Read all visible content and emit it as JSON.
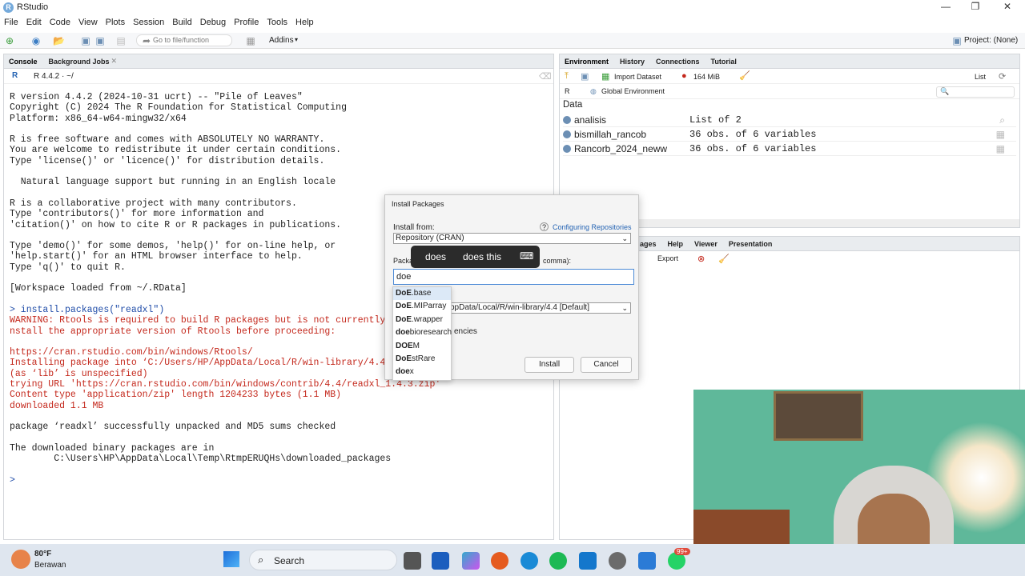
{
  "window": {
    "title": "RStudio"
  },
  "menu": [
    "File",
    "Edit",
    "Code",
    "View",
    "Plots",
    "Session",
    "Build",
    "Debug",
    "Profile",
    "Tools",
    "Help"
  ],
  "toolbar": {
    "goto_placeholder": "Go to file/function",
    "addins": "Addins",
    "project": "Project: (None)"
  },
  "console": {
    "tabs": [
      "Console",
      "Background Jobs"
    ],
    "version": "R 4.4.2 · ~/",
    "lines": [
      {
        "t": "R version 4.4.2 (2024-10-31 ucrt) -- \"Pile of Leaves\"",
        "c": ""
      },
      {
        "t": "Copyright (C) 2024 The R Foundation for Statistical Computing",
        "c": ""
      },
      {
        "t": "Platform: x86_64-w64-mingw32/x64",
        "c": ""
      },
      {
        "t": "",
        "c": ""
      },
      {
        "t": "R is free software and comes with ABSOLUTELY NO WARRANTY.",
        "c": ""
      },
      {
        "t": "You are welcome to redistribute it under certain conditions.",
        "c": ""
      },
      {
        "t": "Type 'license()' or 'licence()' for distribution details.",
        "c": ""
      },
      {
        "t": "",
        "c": ""
      },
      {
        "t": "  Natural language support but running in an English locale",
        "c": ""
      },
      {
        "t": "",
        "c": ""
      },
      {
        "t": "R is a collaborative project with many contributors.",
        "c": ""
      },
      {
        "t": "Type 'contributors()' for more information and",
        "c": ""
      },
      {
        "t": "'citation()' on how to cite R or R packages in publications.",
        "c": ""
      },
      {
        "t": "",
        "c": ""
      },
      {
        "t": "Type 'demo()' for some demos, 'help()' for on-line help, or",
        "c": ""
      },
      {
        "t": "'help.start()' for an HTML browser interface to help.",
        "c": ""
      },
      {
        "t": "Type 'q()' to quit R.",
        "c": ""
      },
      {
        "t": "",
        "c": ""
      },
      {
        "t": "[Workspace loaded from ~/.RData]",
        "c": ""
      },
      {
        "t": "",
        "c": ""
      },
      {
        "t": "> install.packages(\"readxl\")",
        "c": "blue"
      },
      {
        "t": "WARNING: Rtools is required to build R packages but is not currently i",
        "c": "red"
      },
      {
        "t": "nstall the appropriate version of Rtools before proceeding:",
        "c": "red"
      },
      {
        "t": "",
        "c": ""
      },
      {
        "t": "https://cran.rstudio.com/bin/windows/Rtools/",
        "c": "red"
      },
      {
        "t": "Installing package into ‘C:/Users/HP/AppData/Local/R/win-library/4.4’",
        "c": "red"
      },
      {
        "t": "(as ‘lib’ is unspecified)",
        "c": "red"
      },
      {
        "t": "trying URL 'https://cran.rstudio.com/bin/windows/contrib/4.4/readxl_1.4.3.zip'",
        "c": "red"
      },
      {
        "t": "Content type 'application/zip' length 1204233 bytes (1.1 MB)",
        "c": "red"
      },
      {
        "t": "downloaded 1.1 MB",
        "c": "red"
      },
      {
        "t": "",
        "c": ""
      },
      {
        "t": "package ‘readxl’ successfully unpacked and MD5 sums checked",
        "c": ""
      },
      {
        "t": "",
        "c": ""
      },
      {
        "t": "The downloaded binary packages are in",
        "c": ""
      },
      {
        "t": "        C:\\Users\\HP\\AppData\\Local\\Temp\\RtmpERUQHs\\downloaded_packages",
        "c": ""
      },
      {
        "t": "",
        "c": ""
      },
      {
        "t": "> ",
        "c": "blue"
      }
    ]
  },
  "environment": {
    "tabs": [
      "Environment",
      "History",
      "Connections",
      "Tutorial"
    ],
    "import_dataset": "Import Dataset",
    "memory": "164 MiB",
    "list_label": "List",
    "r_label": "R",
    "scope": "Global Environment",
    "section": "Data",
    "rows": [
      {
        "name": "analisis",
        "value": "List of  2"
      },
      {
        "name": "bismillah_rancob",
        "value": "36 obs. of 6 variables"
      },
      {
        "name": "Rancorb_2024_neww",
        "value": "36 obs. of 6 variables"
      }
    ]
  },
  "files_pane": {
    "tabs": [
      "ages",
      "Help",
      "Viewer",
      "Presentation"
    ],
    "export": "Export"
  },
  "dialog": {
    "title": "Install Packages",
    "install_from_label": "Install from:",
    "configuring": "Configuring Repositories",
    "install_from_value": "Repository (CRAN)",
    "packages_label_left": "Packa",
    "packages_label_right": "comma):",
    "packages_value": "doe",
    "library_value": "ppData/Local/R/win-library/4.4 [Default]",
    "deps_label": "encies",
    "install_btn": "Install",
    "cancel_btn": "Cancel"
  },
  "autocomplete": [
    {
      "b": "DoE",
      "r": ".base"
    },
    {
      "b": "DoE",
      "r": ".MIParray"
    },
    {
      "b": "DoE",
      "r": ".wrapper"
    },
    {
      "b": "doe",
      "r": "bioresearch"
    },
    {
      "b": "DOE",
      "r": "M"
    },
    {
      "b": "DoE",
      "r": "stRare"
    },
    {
      "b": "doe",
      "r": "x"
    }
  ],
  "tooltip": {
    "word1": "does",
    "word2": "does this"
  },
  "taskbar": {
    "temp": "80°F",
    "weather": "Berawan",
    "search": "Search",
    "badge": "99+"
  }
}
